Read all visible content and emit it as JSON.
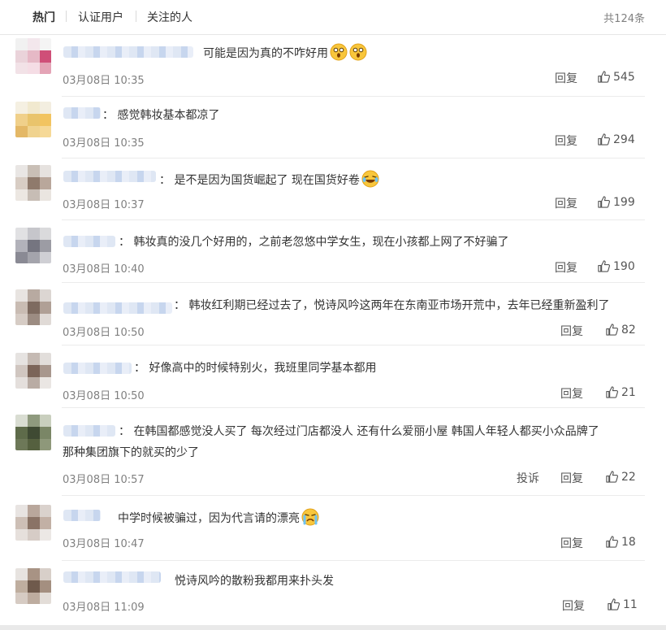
{
  "tabs": [
    {
      "label": "热门",
      "active": true
    },
    {
      "label": "认证用户",
      "active": false
    },
    {
      "label": "关注的人",
      "active": false
    }
  ],
  "total": "共124条",
  "actions": {
    "reply": "回复",
    "report": "投诉"
  },
  "icons": {
    "like": "thumbs-up-icon",
    "emoji_wow": "surprised-face-icon",
    "emoji_laugh": "laughing-crying-face-icon",
    "emoji_cry": "crying-face-icon"
  },
  "comments": [
    {
      "text": "可能是因为真的不咋好用",
      "time": "03月08日 10:35",
      "likes": "545"
    },
    {
      "text": "感觉韩妆基本都凉了",
      "time": "03月08日 10:35",
      "likes": "294"
    },
    {
      "text": "是不是因为国货崛起了 现在国货好卷",
      "time": "03月08日 10:37",
      "likes": "199"
    },
    {
      "text": "韩妆真的没几个好用的，之前老忽悠中学女生，现在小孩都上网了不好骗了",
      "time": "03月08日 10:40",
      "likes": "190"
    },
    {
      "text": "韩妆红利期已经过去了，悦诗风吟这两年在东南亚市场开荒中，去年已经重新盈利了",
      "time": "03月08日 10:50",
      "likes": "82"
    },
    {
      "text": "好像高中的时候特别火，我班里同学基本都用",
      "time": "03月08日 10:50",
      "likes": "21"
    },
    {
      "text": "在韩国都感觉没人买了 每次经过门店都没人 还有什么爱丽小屋 韩国人年轻人都买小众品牌了",
      "text2": "那种集团旗下的就买的少了",
      "time": "03月08日 10:57",
      "likes": "22"
    },
    {
      "text": "中学时候被骗过，因为代言请的漂亮",
      "time": "03月08日 10:47",
      "likes": "18"
    },
    {
      "text": "悦诗风吟的散粉我都用来扑头发",
      "time": "03月08日 11:09",
      "likes": "11"
    }
  ]
}
